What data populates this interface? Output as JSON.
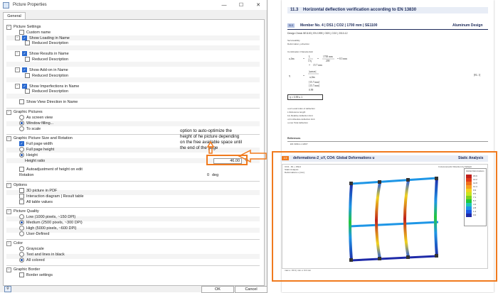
{
  "dialog": {
    "title": "Picture Properties",
    "tab": "General",
    "ok_label": "OK",
    "cancel_label": "Cancel",
    "sections": {
      "picture_settings": {
        "title": "Picture Settings",
        "custom_name": "Custom name",
        "show_loading": "Show Loading in Name",
        "reduced1": "Reduced Description",
        "show_results": "Show Results in Name",
        "reduced2": "Reduced Description",
        "show_addon": "Show Add-on in Name",
        "reduced3": "Reduced Description",
        "show_imperfections": "Show Imperfections in Name",
        "reduced4": "Reduced Description",
        "show_view_direction": "Show View Direction in Name"
      },
      "graphic_pictures": {
        "title": "Graphic Pictures",
        "as_screen_view": "As screen view",
        "window_filling": "Window filling...",
        "to_scale": "To scale"
      },
      "size_rotation": {
        "title": "Graphic Picture Size and Rotation",
        "full_page_width": "Full page width",
        "full_page_height": "Full page height",
        "height": "Height",
        "height_ratio": "Height ratio",
        "height_ratio_value": "46.00",
        "height_ratio_unit": "%",
        "autoadjust": "Autoadjustment of height on edit",
        "rotation": "Rotation",
        "rotation_value": "0",
        "rotation_unit": "deg"
      },
      "options": {
        "title": "Options",
        "pdf": "3D picture in PDF",
        "interaction": "Interaction diagram | Result table",
        "all_table": "All table values"
      },
      "quality": {
        "title": "Picture Quality",
        "low": "Low (1000 pixels, ~150 DPI)",
        "medium": "Medium (2500 pixels, ~300 DPI)",
        "high": "High (5000 pixels, ~600 DPI)",
        "user": "User-Defined"
      },
      "color": {
        "title": "Color",
        "grayscale": "Grayscale",
        "text_black": "Text and lines in black",
        "all_colored": "All colored"
      },
      "border": {
        "title": "Graphic Border",
        "border_settings": "Border settings"
      }
    }
  },
  "annotation": {
    "text": "option to auto-optimize the height of he picture depending on the free available space until the end of the page"
  },
  "report": {
    "chapter_no": "11.3",
    "chapter_title": "Horizontal deflection verification according to EN 13830",
    "member_tag": "SLS",
    "member_title": "Member No. 4 | DS1 | CO2 | 1700 mm | SE1100",
    "member_material": "Aluminum Design",
    "design_line": "Design Check 5E1100 | EN 1999 | ODS | CO2 | 2010-12",
    "serviceability": "Serviceability",
    "deformation_dir": "Deformation y-direction",
    "combination": "Combination Characteristic",
    "ratio_label": "[EL 1]",
    "eta": "η = 0.99 ≤ 1",
    "legend_items": [
      "u,rel   Local index of deflection",
      "L       Reference length",
      "1/η     Relative deflection limit",
      "u,lim   Absolute deflection limit",
      "u,max   Total deflection"
    ],
    "references_title": "References",
    "reference1": "EN 1999-1-1:2007",
    "figure_tag": "4.5",
    "figure_title": "deformations-2_uY, CO4: Global Deformations u",
    "figure_kind": "Static Analysis",
    "fig_sub1": "CO4 - DL + Wind",
    "fig_sub2": "Static Analysis",
    "fig_sub3": "Deformations u [mm]",
    "fig_dir": "In Axonometric Direction by Default",
    "fig_foot": "max u: 15.6 | min u: 0.0 mm",
    "legend_title": "Global Deformations",
    "legend_values": [
      "15.6",
      "14.2",
      "12.8",
      "11.4",
      "9.9",
      "8.5",
      "7.1",
      "5.7",
      "4.3",
      "2.8",
      "1.4",
      "0.0"
    ],
    "legend_colors": [
      "#c0201a",
      "#e03a1a",
      "#f0701e",
      "#f6a01e",
      "#f0d21e",
      "#c8e41e",
      "#7ed21e",
      "#22c83a",
      "#1ec8b4",
      "#1e96e6",
      "#1e5ae6",
      "#1e2aa8"
    ]
  }
}
